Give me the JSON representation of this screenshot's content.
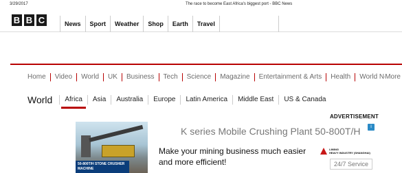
{
  "print_header": {
    "date": "3/29/2017",
    "title": "The race to become East Africa's biggest port - BBC News"
  },
  "logo": {
    "letters": [
      "B",
      "B",
      "C"
    ]
  },
  "top_nav": [
    "News",
    "Sport",
    "Weather",
    "Shop",
    "Earth",
    "Travel"
  ],
  "section_nav": {
    "items": [
      "Home",
      "Video",
      "World",
      "UK",
      "Business",
      "Tech",
      "Science",
      "Magazine",
      "Entertainment & Arts",
      "Health",
      "World News"
    ],
    "more": "More"
  },
  "sub_nav": {
    "heading": "World",
    "items": [
      "Africa",
      "Asia",
      "Australia",
      "Europe",
      "Latin America",
      "Middle East",
      "US & Canada"
    ],
    "active": "Africa"
  },
  "advertisement": {
    "label": "ADVERTISEMENT",
    "image_caption": "50-800T/H STONE CRUSHER MACHINE",
    "headline": "K series Mobile Crushing Plant 50-800T/H",
    "body": "Make your mining business much easier and more efficient!",
    "brand_name": "LIMING",
    "brand_line": "HEAVY INDUSTRY (SHANGHAI)",
    "service": "24/7 Service"
  },
  "colors": {
    "accent_red": "#b80000",
    "ad_blue": "#0b3d7a"
  }
}
